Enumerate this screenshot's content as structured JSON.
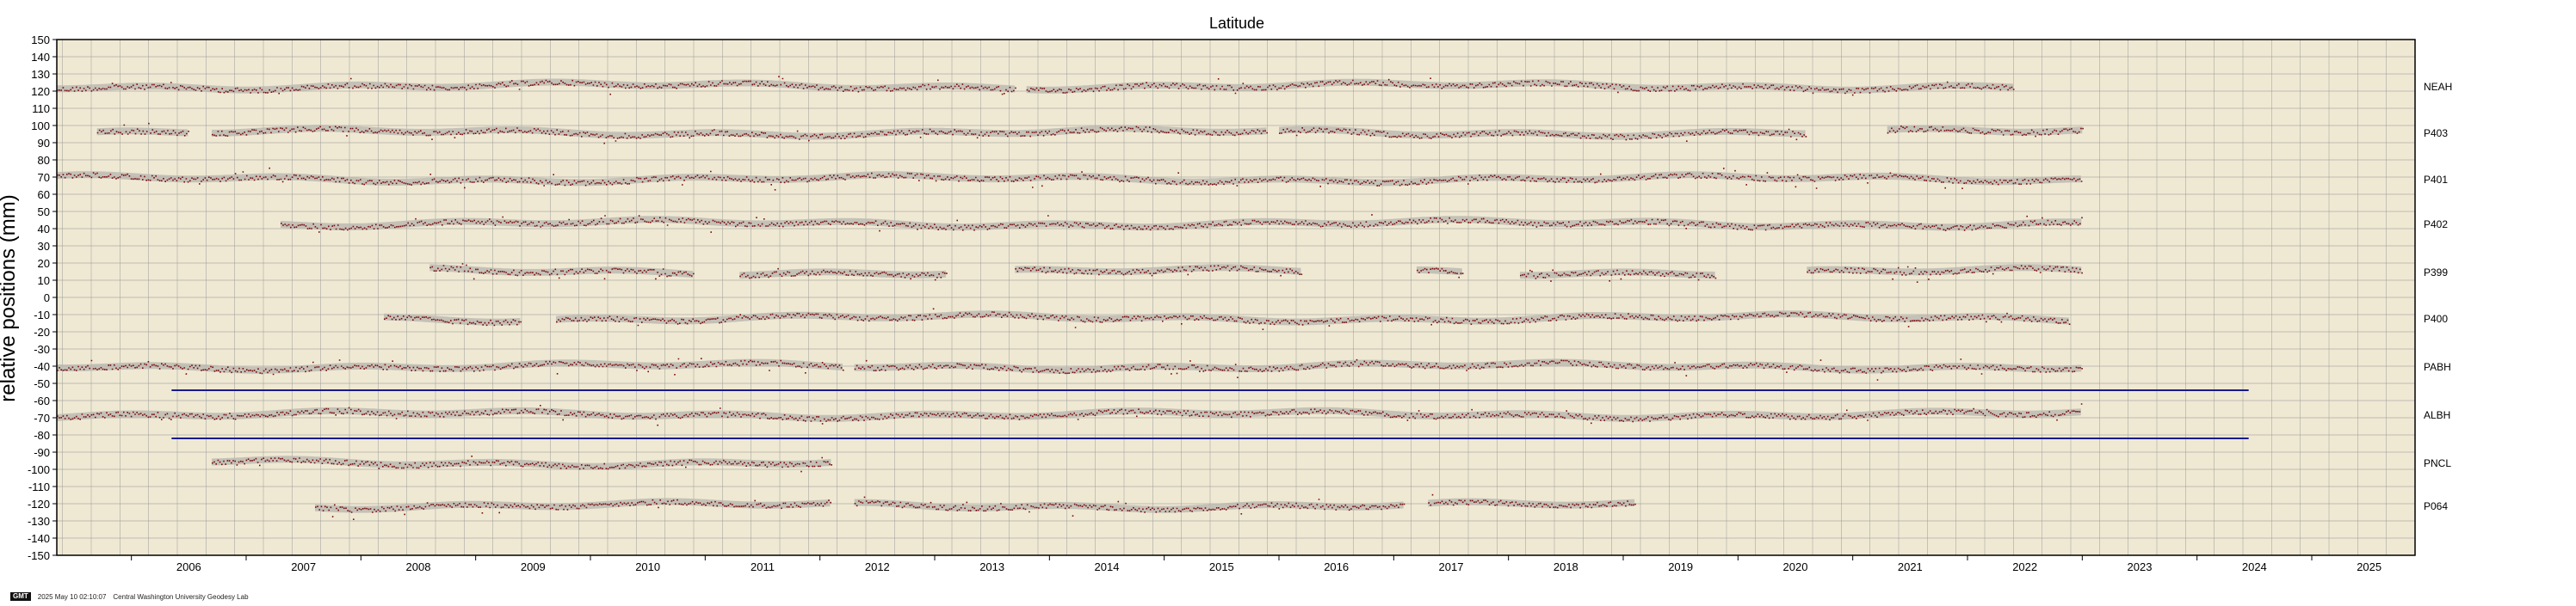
{
  "chart_data": {
    "type": "scatter",
    "title": "Latitude",
    "xlabel": "",
    "ylabel": "relative positions (mm)",
    "xlim": [
      2005.35,
      2025.9
    ],
    "ylim": [
      -150,
      150
    ],
    "y_ticks": [
      150,
      140,
      130,
      120,
      110,
      100,
      90,
      80,
      70,
      60,
      50,
      40,
      30,
      20,
      10,
      0,
      -10,
      -20,
      -30,
      -40,
      -50,
      -60,
      -70,
      -80,
      -90,
      -100,
      -110,
      -120,
      -130,
      -140,
      -150
    ],
    "x_tick_labels": [
      "2006",
      "2007",
      "2008",
      "2009",
      "2010",
      "2011",
      "2012",
      "2013",
      "2014",
      "2015",
      "2016",
      "2017",
      "2018",
      "2019",
      "2020",
      "2021",
      "2022",
      "2023",
      "2024",
      "2025"
    ],
    "grid": true,
    "background_color": "#efe9d3",
    "point_color": "#7a0a0a",
    "band_color": "#b9b6b0",
    "reference_line_color": "#1a1a8c",
    "series": [
      {
        "name": "NEAH",
        "offset": 123,
        "segments": [
          [
            2005.35,
            2013.7
          ],
          [
            2013.8,
            2022.4
          ]
        ]
      },
      {
        "name": "P403",
        "offset": 96,
        "segments": [
          [
            2005.7,
            2006.5
          ],
          [
            2006.7,
            2015.9
          ],
          [
            2016.0,
            2020.6
          ],
          [
            2021.3,
            2023.0
          ]
        ]
      },
      {
        "name": "P401",
        "offset": 69,
        "segments": [
          [
            2005.35,
            2023.0
          ]
        ]
      },
      {
        "name": "P402",
        "offset": 43,
        "segments": [
          [
            2007.3,
            2023.0
          ]
        ]
      },
      {
        "name": "P399",
        "offset": 15,
        "segments": [
          [
            2008.6,
            2010.9
          ],
          [
            2011.3,
            2013.1
          ],
          [
            2013.7,
            2016.2
          ],
          [
            2017.2,
            2017.6
          ],
          [
            2018.1,
            2019.8
          ],
          [
            2020.6,
            2023.0
          ]
        ]
      },
      {
        "name": "P400",
        "offset": -12,
        "segments": [
          [
            2008.2,
            2009.4
          ],
          [
            2009.7,
            2022.9
          ]
        ]
      },
      {
        "name": "PABH",
        "offset": -40,
        "segments": [
          [
            2005.35,
            2012.2
          ],
          [
            2012.3,
            2023.0
          ]
        ]
      },
      {
        "name": "ALBH",
        "offset": -68,
        "segments": [
          [
            2005.35,
            2023.0
          ]
        ]
      },
      {
        "name": "PNCL",
        "offset": -96,
        "segments": [
          [
            2006.7,
            2012.1
          ]
        ]
      },
      {
        "name": "P064",
        "offset": -121,
        "segments": [
          [
            2007.6,
            2012.1
          ],
          [
            2012.3,
            2017.1
          ],
          [
            2017.3,
            2019.1
          ]
        ]
      }
    ],
    "reference_lines": [
      {
        "y": -54,
        "x": [
          2006.35,
          2024.45
        ]
      },
      {
        "y": -82,
        "x": [
          2006.35,
          2024.45
        ]
      }
    ]
  },
  "footer": {
    "badge": "GMT",
    "timestamp": "2025 May 10 02:10:07",
    "credit": "Central Washington University Geodesy Lab"
  }
}
